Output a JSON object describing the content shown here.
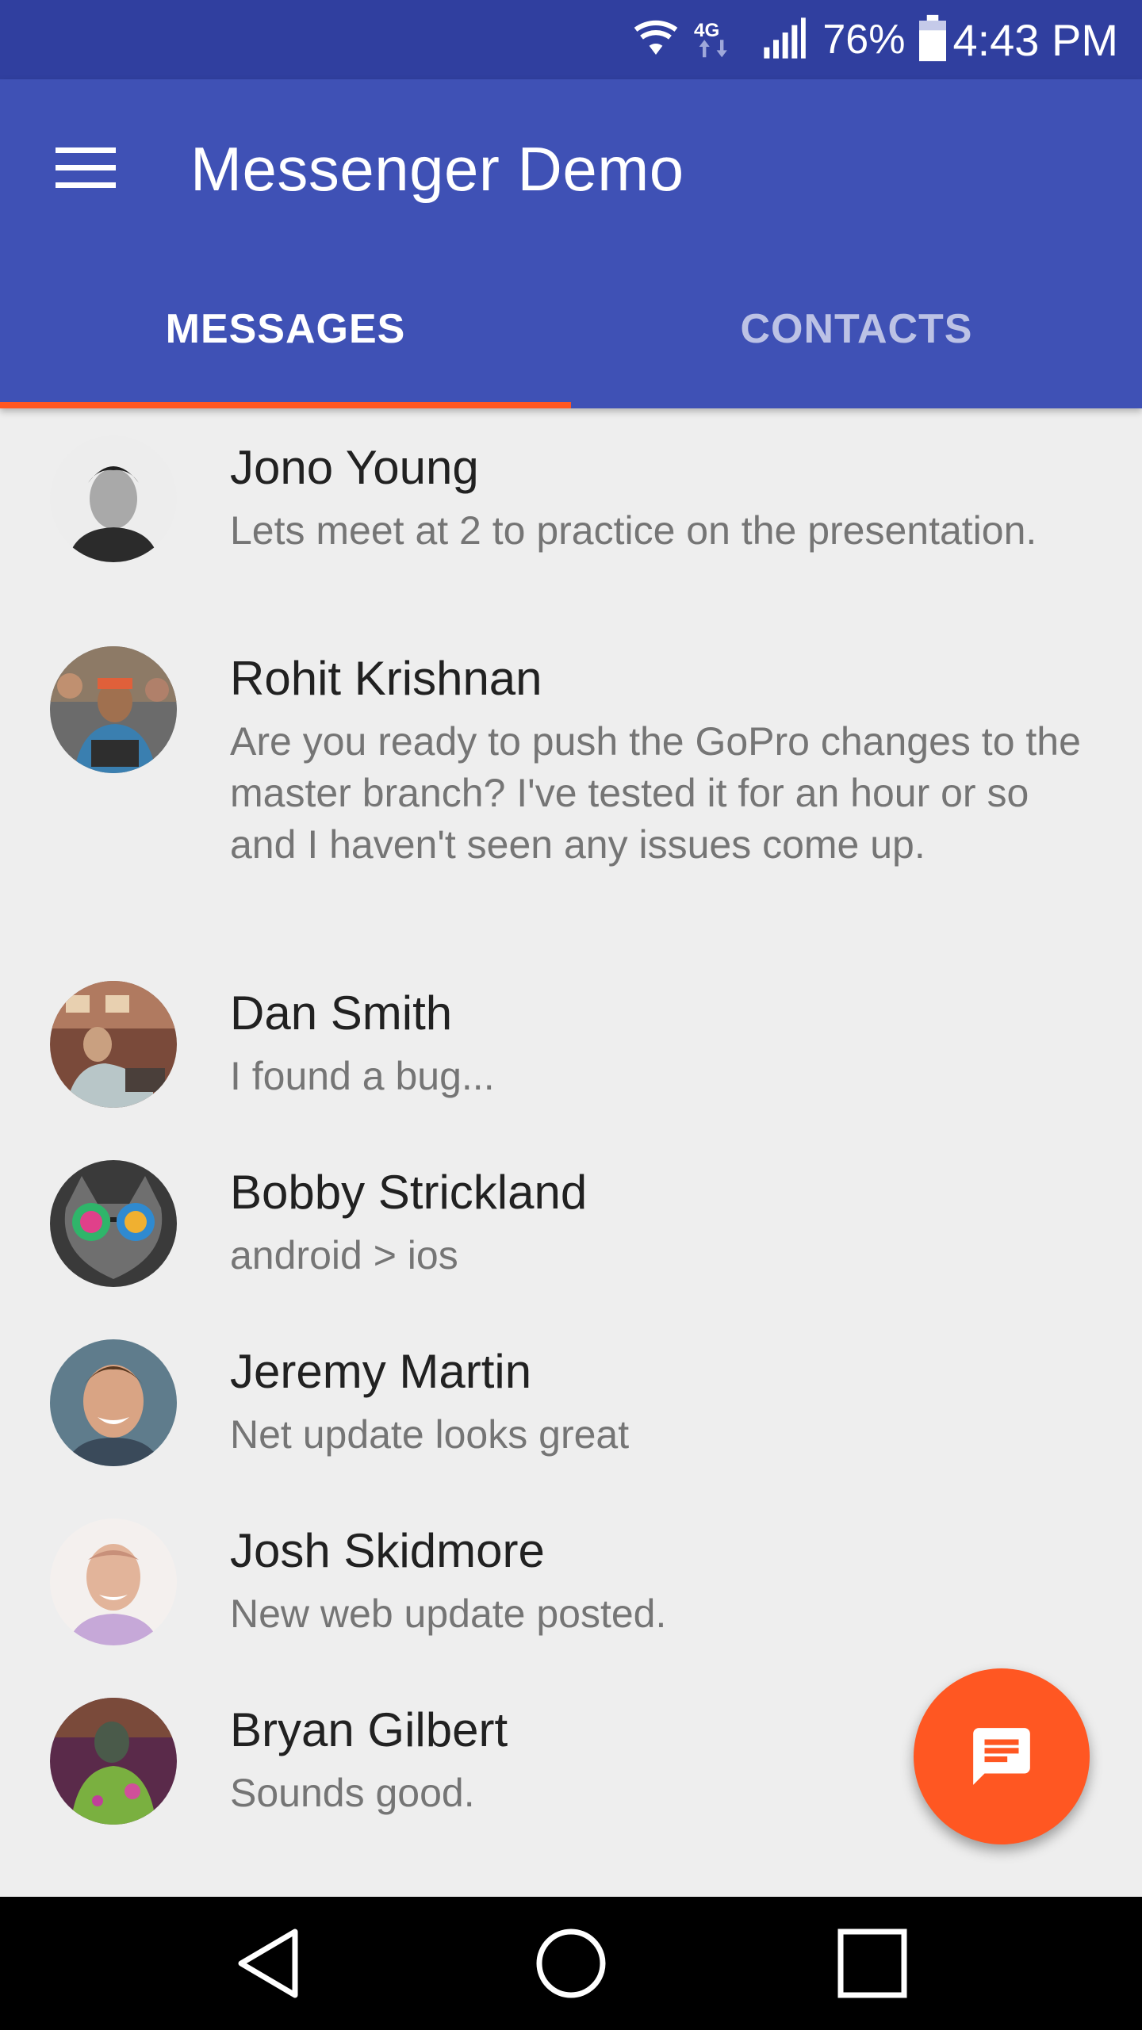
{
  "status_bar": {
    "icons": [
      "wifi-icon",
      "4g-lte-icon",
      "signal-icon",
      "battery-icon"
    ],
    "battery": "76%",
    "time": "4:43 PM"
  },
  "app_bar": {
    "menu_icon": "hamburger-menu-icon",
    "title": "Messenger Demo"
  },
  "tabs": [
    {
      "label": "MESSAGES",
      "active": true
    },
    {
      "label": "CONTACTS",
      "active": false
    }
  ],
  "conversations": [
    {
      "name": "Jono Young",
      "message": "Lets meet at 2 to practice on the presentation."
    },
    {
      "name": "Rohit Krishnan",
      "message": "Are you ready to push the GoPro changes to the master branch? I've tested it for an hour or so and I haven't seen any issues come up."
    },
    {
      "name": "Dan Smith",
      "message": "I found a bug..."
    },
    {
      "name": "Bobby Strickland",
      "message": "android > ios"
    },
    {
      "name": "Jeremy Martin",
      "message": "Net update looks great"
    },
    {
      "name": "Josh Skidmore",
      "message": "New web update posted."
    },
    {
      "name": "Bryan Gilbert",
      "message": "Sounds good."
    }
  ],
  "fab": {
    "icon": "message-icon"
  },
  "nav_bar": {
    "icons": [
      "back-icon",
      "home-icon",
      "recents-icon"
    ]
  },
  "colors": {
    "primary": "#3F51B5",
    "primary_dark": "#303F9F",
    "accent": "#FF5722",
    "background": "#EEEEEE"
  }
}
